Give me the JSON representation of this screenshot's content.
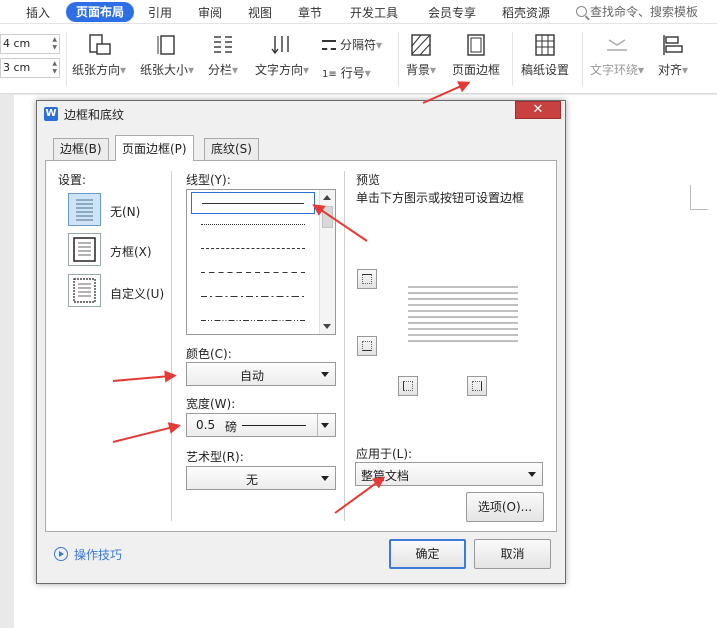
{
  "menu": {
    "items": [
      "插入",
      "页面布局",
      "引用",
      "审阅",
      "视图",
      "章节",
      "开发工具",
      "会员专享",
      "稻壳资源"
    ],
    "active": "页面布局",
    "search_label": "查找命令、搜索模板"
  },
  "ribbon": {
    "spin1": "4 cm",
    "spin2": "3 cm",
    "paper_orientation": "纸张方向",
    "paper_size": "纸张大小",
    "columns": "分栏",
    "text_direction": "文字方向",
    "separator": "分隔符",
    "line_numbers": "行号",
    "background": "背景",
    "page_border": "页面边框",
    "manuscript": "稿纸设置",
    "text_wrap": "文字环绕",
    "align": "对齐"
  },
  "dialog": {
    "title": "边框和底纹",
    "tabs": [
      "边框(B)",
      "页面边框(P)",
      "底纹(S)"
    ],
    "active_tab": "页面边框(P)",
    "settings_label": "设置:",
    "settings": [
      "无(N)",
      "方框(X)",
      "自定义(U)"
    ],
    "line_style_label": "线型(Y):",
    "color_label": "颜色(C):",
    "color_value": "自动",
    "width_label": "宽度(W):",
    "width_value": "0.5",
    "width_unit": "磅",
    "art_label": "艺术型(R):",
    "art_value": "无",
    "preview_label": "预览",
    "preview_hint": "单击下方图示或按钮可设置边框",
    "apply_label": "应用于(L):",
    "apply_value": "整篇文档",
    "options_button": "选项(O)...",
    "tips_link": "操作技巧",
    "ok_button": "确定",
    "cancel_button": "取消"
  },
  "colors": {
    "accent": "#2f6fe6",
    "annotation_arrow": "#e53935"
  }
}
